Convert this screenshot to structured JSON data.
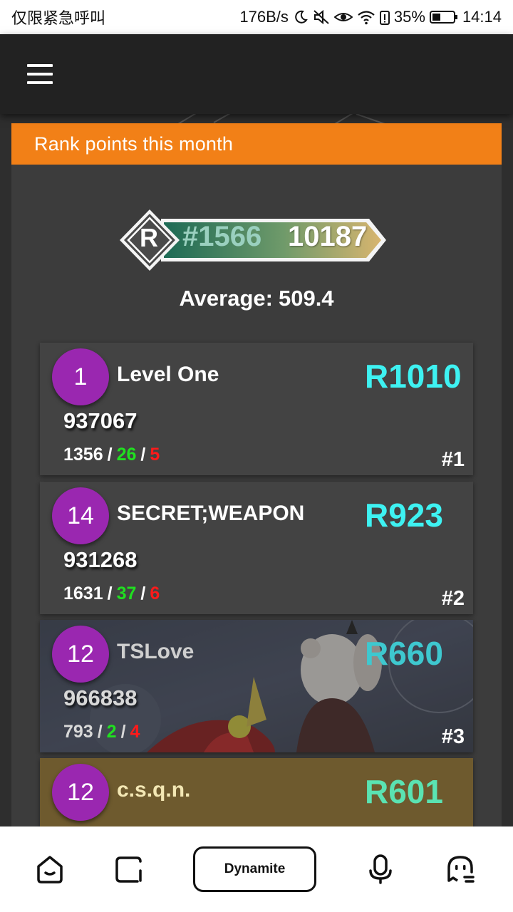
{
  "status_bar": {
    "carrier": "仅限紧急呼叫",
    "speed": "176B/s",
    "battery": "35%",
    "time": "14:14"
  },
  "header": {
    "menu_icon": "menu-icon"
  },
  "panel": {
    "title": "Rank points this month",
    "rank_letter": "R",
    "rank_position": "#1566",
    "rank_points": "10187",
    "average_label": "Average:",
    "average_value": "509.4"
  },
  "records": [
    {
      "level": "1",
      "title": "Level One",
      "rating": "R1010",
      "score": "937067",
      "perfect": "1356",
      "good": "26",
      "miss": "5",
      "place": "#1"
    },
    {
      "level": "14",
      "title": "SECRET;WEAPON",
      "rating": "R923",
      "score": "931268",
      "perfect": "1631",
      "good": "37",
      "miss": "6",
      "place": "#2"
    },
    {
      "level": "12",
      "title": "TSLove",
      "rating": "R660",
      "score": "966838",
      "perfect": "793",
      "good": "2",
      "miss": "4",
      "place": "#3"
    },
    {
      "level": "12",
      "title": "c.s.q.n.",
      "rating": "R601"
    }
  ],
  "bottom_nav": {
    "home_icon": "home-icon",
    "library_icon": "library-icon",
    "center_label": "Dynamite",
    "mic_icon": "microphone-icon",
    "profile_icon": "ghost-profile-icon"
  },
  "colors": {
    "accent_orange": "#f28017",
    "level_purple": "#9a27b0",
    "rating_cyan": "#3ef2f2",
    "good_green": "#20e020",
    "miss_red": "#ff1a1a"
  }
}
